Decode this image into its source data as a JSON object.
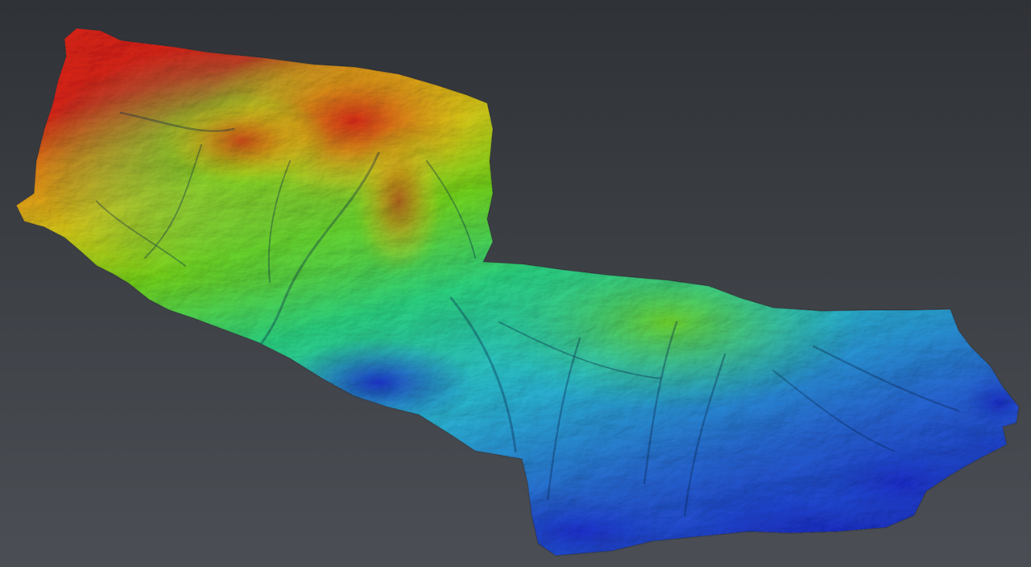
{
  "viewer": {
    "background": {
      "top": "#2f3236",
      "bottom": "#4b4f55"
    },
    "colormap": [
      {
        "stop": 0.0,
        "color": "#1d2fd6"
      },
      {
        "stop": 0.18,
        "color": "#2a6fe0"
      },
      {
        "stop": 0.38,
        "color": "#2fc9e0"
      },
      {
        "stop": 0.55,
        "color": "#2fe08a"
      },
      {
        "stop": 0.7,
        "color": "#7ce21e"
      },
      {
        "stop": 0.82,
        "color": "#e8d21c"
      },
      {
        "stop": 0.92,
        "color": "#ef8a17"
      },
      {
        "stop": 1.0,
        "color": "#e8261a"
      }
    ],
    "peak_color": "#e8261a",
    "low_color": "#1d2fd6",
    "mid_color": "#2fe08a"
  }
}
